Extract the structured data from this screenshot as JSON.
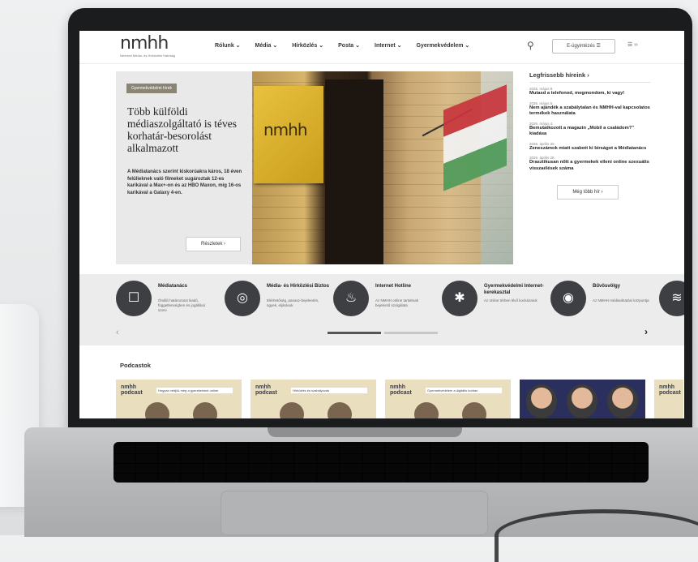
{
  "header": {
    "logo": "nmhh",
    "logo_tagline": "Nemzeti Média- és Hírközlési Hatóság",
    "nav": [
      "Rólunk ⌄",
      "Média ⌄",
      "Hírközlés ⌄",
      "Posta ⌄",
      "Internet ⌄",
      "Gyermekvédelem ⌄"
    ],
    "login_label": "E-ügyintézés ☰",
    "lang_label": "☰ ‹›"
  },
  "hero": {
    "badge": "Gyermekvédelmi hírek",
    "title": "Több külföldi médiaszolgáltató is téves korhatár-besorolást alkalmazott",
    "description": "A Médiatanács szerint kiskorúakra káros, 18 éven felülieknek való filmeket sugároztak 12-es karikával a Max+-on és az HBO Maxon, míg 16-os karikával a Galaxy 4-en.",
    "button": "Részletek ›",
    "image_sign": "nmhh"
  },
  "news": {
    "heading": "Legfrissebb híreink ›",
    "items": [
      {
        "date": "2026. május 8.",
        "title": "Mutasd a telefonod, megmondom, ki vagy!"
      },
      {
        "date": "2026. május 5.",
        "title": "Nem ajándék a szabálytalan és NMHH-val kapcsolatos termékek használata"
      },
      {
        "date": "2026. május 4.",
        "title": "Bemutatkozott a magazin „Mobil a családom?” kiadása"
      },
      {
        "date": "2026. április 30.",
        "title": "Zeneszámok miatt szabott ki bírságot a Médiatanács"
      },
      {
        "date": "2026. április 28.",
        "title": "Drasztikusan nőtt a gyermekek elleni online szexuális visszaélések száma"
      }
    ],
    "more_button": "Még több hír ›"
  },
  "services": [
    {
      "name": "Médiatanács",
      "desc": "Önálló határozatot kiadó, függetlenségben és jogállású szerv",
      "icon": "☐"
    },
    {
      "name": "Média- és Hírközlési Biztos",
      "desc": "Elérhetőség, panasz-bejelentés, ügyek, eljárások",
      "icon": "◎"
    },
    {
      "name": "Internet Hotline",
      "desc": "Az NMHH online tartalmak bejelentő szolgálata",
      "icon": "♨"
    },
    {
      "name": "Gyermekvédelmi Internet-kerekasztal",
      "desc": "Az online térben lévő kockázatok",
      "icon": "✱"
    },
    {
      "name": "Bűvösvölgy",
      "desc": "Az NMHH médiaoktatási központja",
      "icon": "◉"
    }
  ],
  "carousel": {
    "prev": "‹",
    "next": "›"
  },
  "podcasts": {
    "heading": "Podcastok",
    "items": [
      {
        "logo": "nmhh podcast",
        "title": "Hogyan védjük meg a gyerekeinket online"
      },
      {
        "logo": "nmhh podcast",
        "title": "Hírközlés és szabályozás"
      },
      {
        "logo": "nmhh podcast",
        "title": "Gyermekvédelem a digitális korban"
      },
      {
        "logo": "",
        "title": ""
      },
      {
        "logo": "nmhh podcast",
        "title": ""
      }
    ]
  },
  "colors": {
    "badge_bg": "#8b8575",
    "service_circle": "#3d3f43",
    "podcast_bg": "#e9dfbf"
  }
}
